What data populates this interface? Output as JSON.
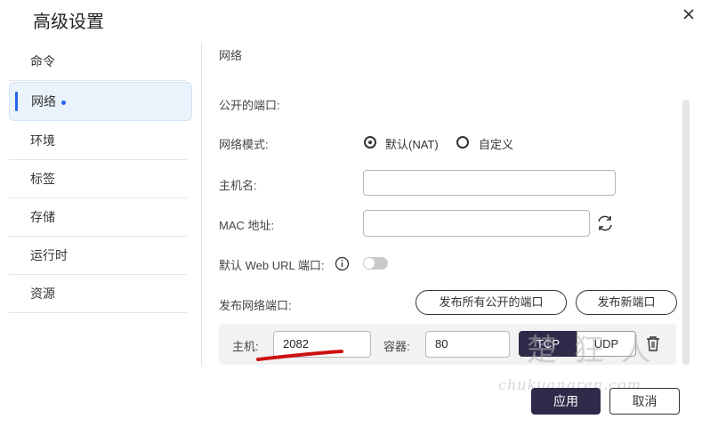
{
  "dialog": {
    "title": "高级设置"
  },
  "sidebar": {
    "items": [
      {
        "label": "命令"
      },
      {
        "label": "网络"
      },
      {
        "label": "环境"
      },
      {
        "label": "标签"
      },
      {
        "label": "存储"
      },
      {
        "label": "运行时"
      },
      {
        "label": "资源"
      }
    ]
  },
  "network": {
    "section_title": "网络",
    "public_ports_label": "公开的端口:",
    "mode_label": "网络模式:",
    "mode_default": "默认(NAT)",
    "mode_custom": "自定义",
    "hostname_label": "主机名:",
    "mac_label": "MAC 地址:",
    "web_url_label": "默认 Web URL 端口:",
    "publish_label": "发布网络端口:",
    "publish_all_button": "发布所有公开的端口",
    "publish_new_button": "发布新端口",
    "host_label": "主机:",
    "host_value": "2082",
    "container_label": "容器:",
    "container_value": "80",
    "tcp_label": "TCP",
    "udp_label": "UDP"
  },
  "footer": {
    "apply_button": "应用",
    "cancel_button": "取消"
  },
  "watermark": {
    "cn": "楚 狂 人",
    "url": "chukuangren.com"
  },
  "colors": {
    "accent": "#2563eb",
    "primary_button": "#2e2b4a",
    "annotation": "#cc1111"
  },
  "state": {
    "network_mode_selected": "默认(NAT)",
    "web_url_toggle_on": false,
    "protocol_selected": "TCP"
  }
}
